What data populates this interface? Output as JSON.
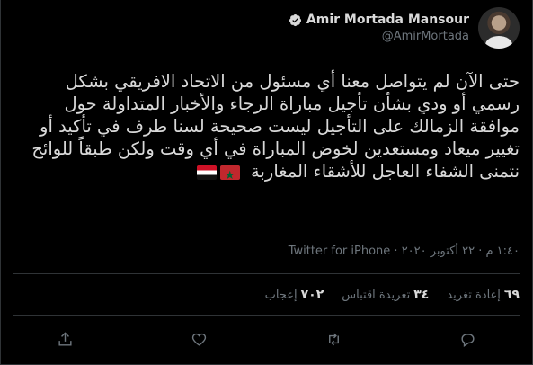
{
  "author": {
    "name": "Amir Mortada Mansour",
    "handle": "@AmirMortada"
  },
  "tweet": {
    "text": "حتى الآن لم يتواصل معنا أي مسئول من الاتحاد الافريقي بشكل رسمي أو ودي بشأن تأجيل مباراة الرجاء والأخبار المتداولة حول موافقة الزمالك على التأجيل ليست صحيحة لسنا طرف في تأكيد أو تغيير ميعاد ومستعدين لخوض المباراة في أي وقت ولكن طبقاً للوائح نتمنى الشفاء العاجل للأشقاء المغاربة",
    "flags": [
      "morocco-flag",
      "egypt-flag"
    ]
  },
  "meta": {
    "text": "١:٤٠ م · ٢٢ أكتوبر ٢٠٢٠ · Twitter for iPhone"
  },
  "stats": {
    "retweets_count": "٦٩",
    "retweets_label": "إعادة تغريد",
    "quotes_count": "٣٤",
    "quotes_label": "تغريدة اقتباس",
    "likes_count": "٧٠٢",
    "likes_label": "إعجاب"
  },
  "actions": [
    "reply-icon",
    "retweet-icon",
    "like-icon",
    "share-icon"
  ],
  "colors": {
    "background": "#000000",
    "text": "#d9d9d9",
    "muted": "#6e767d",
    "divider": "#2f3336"
  }
}
